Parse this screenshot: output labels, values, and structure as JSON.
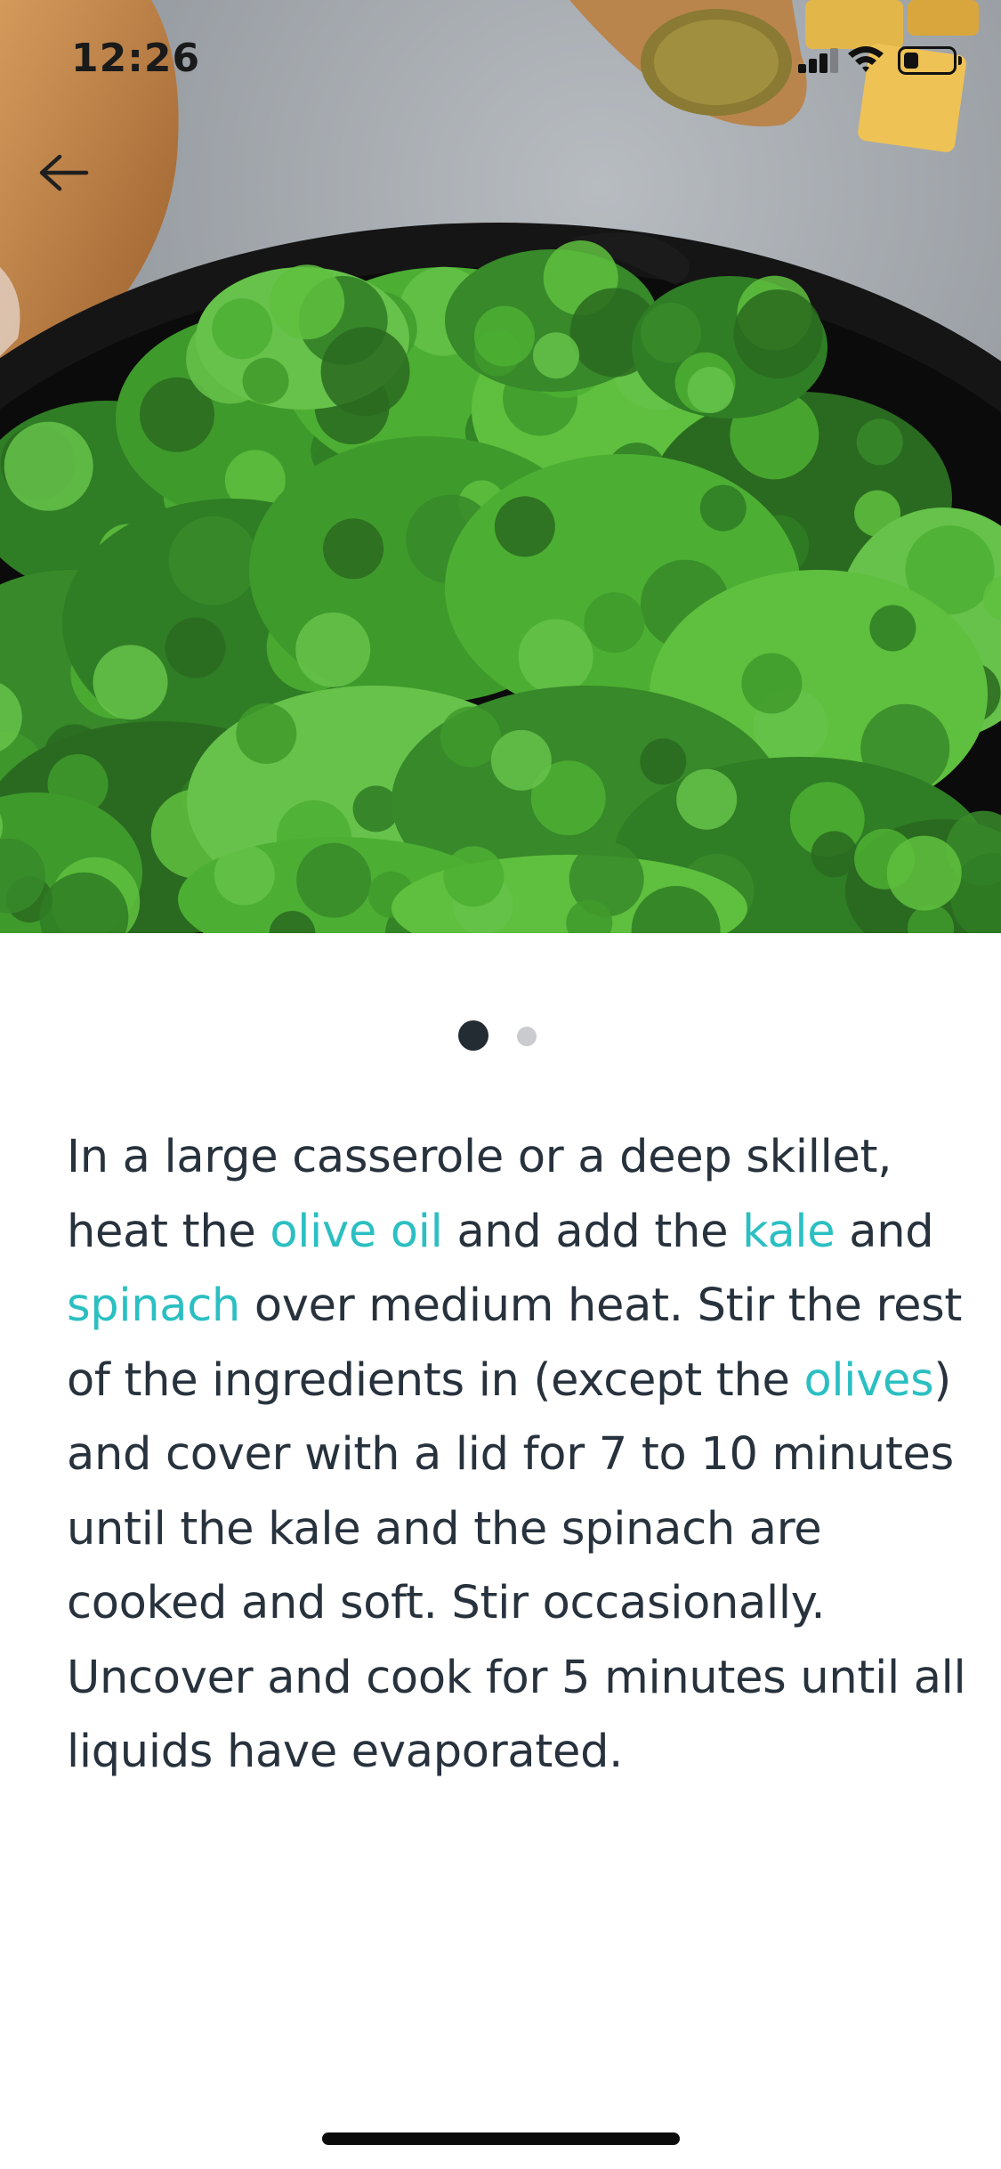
{
  "status_bar": {
    "time": "12:26",
    "signal_icon": "cellular-signal-icon",
    "wifi_icon": "wifi-icon",
    "battery_icon": "battery-icon",
    "battery_level": 0.3
  },
  "navigation": {
    "back_icon": "arrow-left-icon"
  },
  "hero": {
    "image": "kale-and-spinach-in-cast-iron-skillet"
  },
  "pager": {
    "total": 2,
    "active_index": 0,
    "active_color": "#232b33",
    "inactive_color": "#c9cbcf"
  },
  "instruction": {
    "highlight_color": "#2bbfc2",
    "text_color": "#27323d",
    "lines": [
      [
        {
          "t": " In a large casserole or a deep skillet,"
        }
      ],
      [
        {
          "t": "heat the "
        },
        {
          "t": "olive oil",
          "hl": true
        },
        {
          "t": " and add the "
        },
        {
          "t": "kale",
          "hl": true
        },
        {
          "t": " and"
        }
      ],
      [
        {
          "t": "spinach",
          "hl": true
        },
        {
          "t": " over medium heat. Stir the rest"
        }
      ],
      [
        {
          "t": "of the ingredients in (except the "
        },
        {
          "t": "olives",
          "hl": true
        },
        {
          "t": ")"
        }
      ],
      [
        {
          "t": "and cover with a lid for 7 to 10 minutes"
        }
      ],
      [
        {
          "t": "until the kale and the spinach are"
        }
      ],
      [
        {
          "t": "cooked and soft. Stir occasionally."
        }
      ],
      [
        {
          "t": "Uncover and cook for 5 minutes until all"
        }
      ],
      [
        {
          "t": "liquids have evaporated."
        }
      ]
    ]
  }
}
